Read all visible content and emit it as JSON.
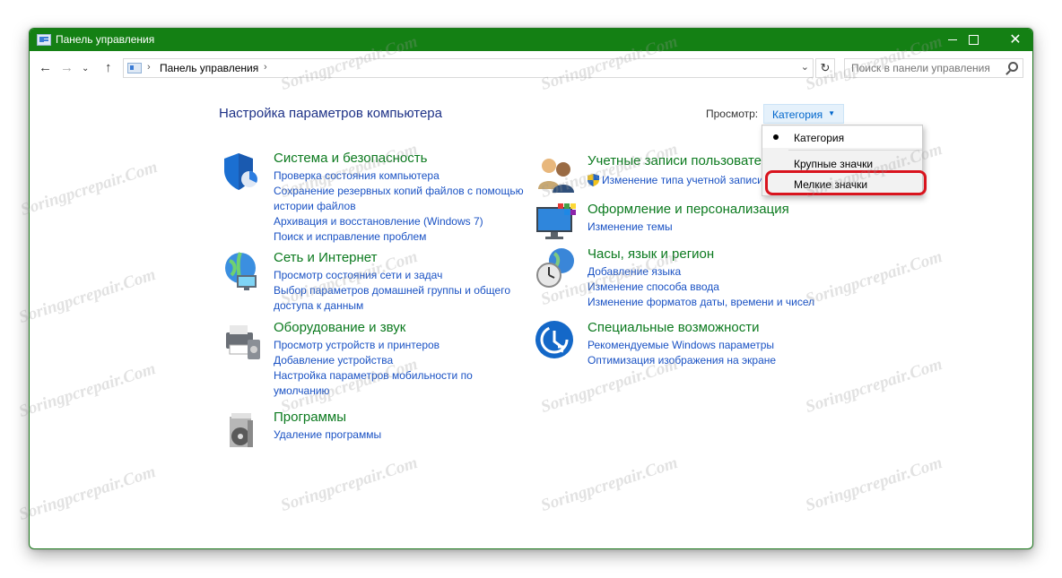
{
  "window": {
    "title": "Панель управления",
    "controls": {
      "minimize": "—",
      "maximize": "☐",
      "close": "✕"
    }
  },
  "address_bar": {
    "back": "←",
    "forward": "→",
    "recent": "⌄",
    "up": "↑",
    "separator": "›",
    "crumb": "Панель управления",
    "dropdown": "⌄",
    "refresh": "↻",
    "search_placeholder": "Поиск в панели управления"
  },
  "main": {
    "heading": "Настройка параметров компьютера",
    "view_label": "Просмотр:",
    "view_selected": "Категория",
    "view_caret": "▼"
  },
  "dropdown": {
    "items": [
      "Категория",
      "Крупные значки",
      "Мелкие значки"
    ],
    "selected_index": 0,
    "highlighted_item": "Мелкие значки",
    "highlight_color": "#d9141e"
  },
  "categories": {
    "system": {
      "icon": "shield-icon",
      "title": "Система и безопасность",
      "links": [
        "Проверка состояния компьютера",
        "Сохранение резервных копий файлов с помощью",
        "истории файлов",
        "Архивация и восстановление (Windows 7)",
        "Поиск и исправление проблем"
      ]
    },
    "network": {
      "icon": "globe-network-icon",
      "title": "Сеть и Интернет",
      "links": [
        "Просмотр состояния сети и задач",
        "Выбор параметров домашней группы и общего",
        "доступа к данным"
      ]
    },
    "hardware": {
      "icon": "printer-icon",
      "title": "Оборудование и звук",
      "links": [
        "Просмотр устройств и принтеров",
        "Добавление устройства",
        "Настройка параметров мобильности по",
        "умолчанию"
      ]
    },
    "programs": {
      "icon": "programs-disc-icon",
      "title": "Программы",
      "links": [
        "Удаление программы"
      ]
    },
    "accounts": {
      "icon": "users-icon",
      "title": "Учетные записи пользовате",
      "links": [
        "Изменение типа учетной записи"
      ]
    },
    "appearance": {
      "icon": "monitor-palette-icon",
      "title": "Оформление и персонализация",
      "links": [
        "Изменение темы"
      ]
    },
    "clock": {
      "icon": "clock-globe-icon",
      "title": "Часы, язык и регион",
      "links": [
        "Добавление языка",
        "Изменение способа ввода",
        "Изменение форматов даты, времени и чисел"
      ]
    },
    "access": {
      "icon": "ease-of-access-icon",
      "title": "Специальные возможности",
      "links": [
        "Рекомендуемые Windows параметры",
        "Оптимизация изображения на экране"
      ]
    }
  },
  "colors": {
    "titlebar": "#148014",
    "heading": "#1e3287",
    "category_title": "#0c7a1f",
    "link": "#1a52c4"
  },
  "watermark": "Soringpcrepair.Com"
}
